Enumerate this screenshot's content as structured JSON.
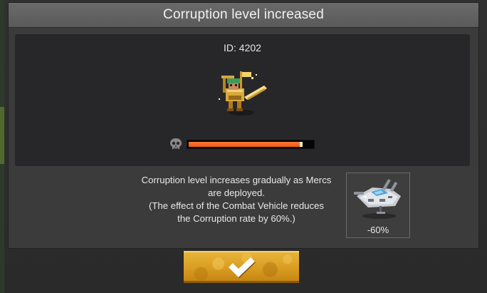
{
  "dialog": {
    "title": "Corruption level increased"
  },
  "merc": {
    "id_label": "ID: 4202",
    "sprite_icon": "merc-sprite-icon"
  },
  "corruption": {
    "icon": "skull-icon",
    "level_fraction": 0.92,
    "fill_color": "#f2561a",
    "tip_color": "#f3e7c8"
  },
  "description": {
    "lines": [
      "Corruption level increases gradually as Mercs",
      "are deployed.",
      "(The effect of the Combat Vehicle reduces",
      "the Corruption rate by 60%.)"
    ]
  },
  "vehicle": {
    "icon": "combat-vehicle-icon",
    "reduction_label": "-60%"
  },
  "confirm": {
    "icon": "checkmark-icon",
    "accent_color": "#e0a52c"
  }
}
